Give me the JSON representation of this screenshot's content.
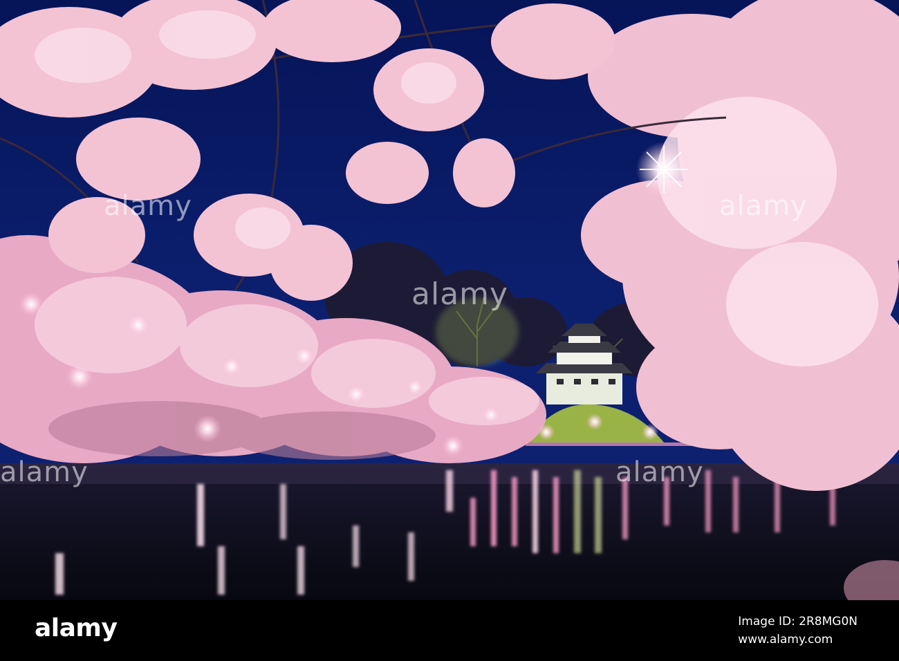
{
  "photo": {
    "subject": "Illuminated cherry blossoms framing a Japanese castle reflected in a moat at night",
    "colors": {
      "sky": "#0b1f6e",
      "sky_deep": "#04124a",
      "blossom": "#f3c3d4",
      "blossom_shadow": "#c98aa3",
      "water": "#0a0c1c",
      "lantern": "#ffd9ea"
    }
  },
  "watermarks": {
    "center": "alamy",
    "top_left": "alamy",
    "top_right": "alamy",
    "mid_left": "alamy",
    "mid_right": "alamy"
  },
  "footer": {
    "logo": "alamy",
    "image_id_label": "Image ID: 2R8MG0N",
    "site": "www.alamy.com"
  }
}
